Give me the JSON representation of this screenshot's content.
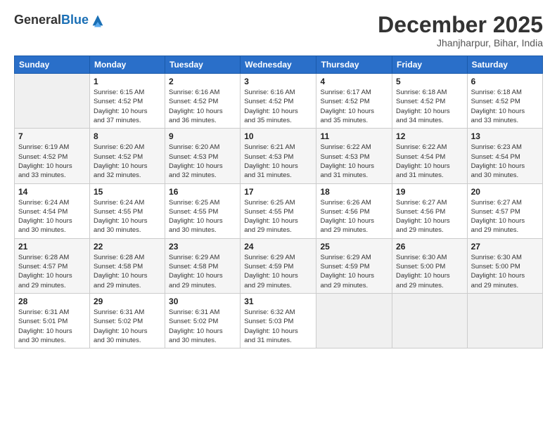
{
  "logo": {
    "general": "General",
    "blue": "Blue"
  },
  "header": {
    "month": "December 2025",
    "location": "Jhanjharpur, Bihar, India"
  },
  "weekdays": [
    "Sunday",
    "Monday",
    "Tuesday",
    "Wednesday",
    "Thursday",
    "Friday",
    "Saturday"
  ],
  "weeks": [
    [
      {
        "day": "",
        "info": ""
      },
      {
        "day": "1",
        "info": "Sunrise: 6:15 AM\nSunset: 4:52 PM\nDaylight: 10 hours\nand 37 minutes."
      },
      {
        "day": "2",
        "info": "Sunrise: 6:16 AM\nSunset: 4:52 PM\nDaylight: 10 hours\nand 36 minutes."
      },
      {
        "day": "3",
        "info": "Sunrise: 6:16 AM\nSunset: 4:52 PM\nDaylight: 10 hours\nand 35 minutes."
      },
      {
        "day": "4",
        "info": "Sunrise: 6:17 AM\nSunset: 4:52 PM\nDaylight: 10 hours\nand 35 minutes."
      },
      {
        "day": "5",
        "info": "Sunrise: 6:18 AM\nSunset: 4:52 PM\nDaylight: 10 hours\nand 34 minutes."
      },
      {
        "day": "6",
        "info": "Sunrise: 6:18 AM\nSunset: 4:52 PM\nDaylight: 10 hours\nand 33 minutes."
      }
    ],
    [
      {
        "day": "7",
        "info": "Sunrise: 6:19 AM\nSunset: 4:52 PM\nDaylight: 10 hours\nand 33 minutes."
      },
      {
        "day": "8",
        "info": "Sunrise: 6:20 AM\nSunset: 4:52 PM\nDaylight: 10 hours\nand 32 minutes."
      },
      {
        "day": "9",
        "info": "Sunrise: 6:20 AM\nSunset: 4:53 PM\nDaylight: 10 hours\nand 32 minutes."
      },
      {
        "day": "10",
        "info": "Sunrise: 6:21 AM\nSunset: 4:53 PM\nDaylight: 10 hours\nand 31 minutes."
      },
      {
        "day": "11",
        "info": "Sunrise: 6:22 AM\nSunset: 4:53 PM\nDaylight: 10 hours\nand 31 minutes."
      },
      {
        "day": "12",
        "info": "Sunrise: 6:22 AM\nSunset: 4:54 PM\nDaylight: 10 hours\nand 31 minutes."
      },
      {
        "day": "13",
        "info": "Sunrise: 6:23 AM\nSunset: 4:54 PM\nDaylight: 10 hours\nand 30 minutes."
      }
    ],
    [
      {
        "day": "14",
        "info": "Sunrise: 6:24 AM\nSunset: 4:54 PM\nDaylight: 10 hours\nand 30 minutes."
      },
      {
        "day": "15",
        "info": "Sunrise: 6:24 AM\nSunset: 4:55 PM\nDaylight: 10 hours\nand 30 minutes."
      },
      {
        "day": "16",
        "info": "Sunrise: 6:25 AM\nSunset: 4:55 PM\nDaylight: 10 hours\nand 30 minutes."
      },
      {
        "day": "17",
        "info": "Sunrise: 6:25 AM\nSunset: 4:55 PM\nDaylight: 10 hours\nand 29 minutes."
      },
      {
        "day": "18",
        "info": "Sunrise: 6:26 AM\nSunset: 4:56 PM\nDaylight: 10 hours\nand 29 minutes."
      },
      {
        "day": "19",
        "info": "Sunrise: 6:27 AM\nSunset: 4:56 PM\nDaylight: 10 hours\nand 29 minutes."
      },
      {
        "day": "20",
        "info": "Sunrise: 6:27 AM\nSunset: 4:57 PM\nDaylight: 10 hours\nand 29 minutes."
      }
    ],
    [
      {
        "day": "21",
        "info": "Sunrise: 6:28 AM\nSunset: 4:57 PM\nDaylight: 10 hours\nand 29 minutes."
      },
      {
        "day": "22",
        "info": "Sunrise: 6:28 AM\nSunset: 4:58 PM\nDaylight: 10 hours\nand 29 minutes."
      },
      {
        "day": "23",
        "info": "Sunrise: 6:29 AM\nSunset: 4:58 PM\nDaylight: 10 hours\nand 29 minutes."
      },
      {
        "day": "24",
        "info": "Sunrise: 6:29 AM\nSunset: 4:59 PM\nDaylight: 10 hours\nand 29 minutes."
      },
      {
        "day": "25",
        "info": "Sunrise: 6:29 AM\nSunset: 4:59 PM\nDaylight: 10 hours\nand 29 minutes."
      },
      {
        "day": "26",
        "info": "Sunrise: 6:30 AM\nSunset: 5:00 PM\nDaylight: 10 hours\nand 29 minutes."
      },
      {
        "day": "27",
        "info": "Sunrise: 6:30 AM\nSunset: 5:00 PM\nDaylight: 10 hours\nand 29 minutes."
      }
    ],
    [
      {
        "day": "28",
        "info": "Sunrise: 6:31 AM\nSunset: 5:01 PM\nDaylight: 10 hours\nand 30 minutes."
      },
      {
        "day": "29",
        "info": "Sunrise: 6:31 AM\nSunset: 5:02 PM\nDaylight: 10 hours\nand 30 minutes."
      },
      {
        "day": "30",
        "info": "Sunrise: 6:31 AM\nSunset: 5:02 PM\nDaylight: 10 hours\nand 30 minutes."
      },
      {
        "day": "31",
        "info": "Sunrise: 6:32 AM\nSunset: 5:03 PM\nDaylight: 10 hours\nand 31 minutes."
      },
      {
        "day": "",
        "info": ""
      },
      {
        "day": "",
        "info": ""
      },
      {
        "day": "",
        "info": ""
      }
    ]
  ]
}
